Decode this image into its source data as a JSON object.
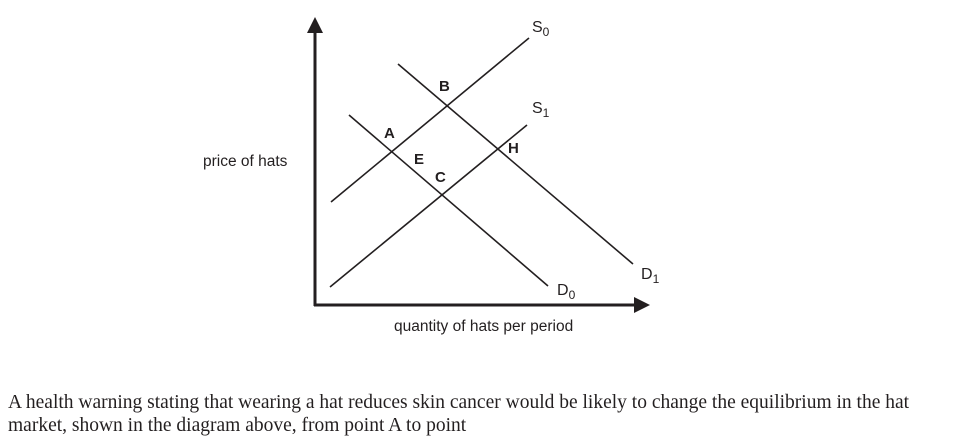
{
  "diagram": {
    "y_axis_label": "price of hats",
    "x_axis_label": "quantity of hats per period",
    "curves": {
      "s0": {
        "letter": "S",
        "sub": "0"
      },
      "s1": {
        "letter": "S",
        "sub": "1"
      },
      "d0": {
        "letter": "D",
        "sub": "0"
      },
      "d1": {
        "letter": "D",
        "sub": "1"
      }
    },
    "points": {
      "a": "A",
      "b": "B",
      "c": "C",
      "e": "E",
      "h": "H"
    }
  },
  "question": "A health warning stating that wearing a hat reduces skin cancer would be likely to change the equilibrium in the hat market, shown in the diagram above, from point A to point"
}
